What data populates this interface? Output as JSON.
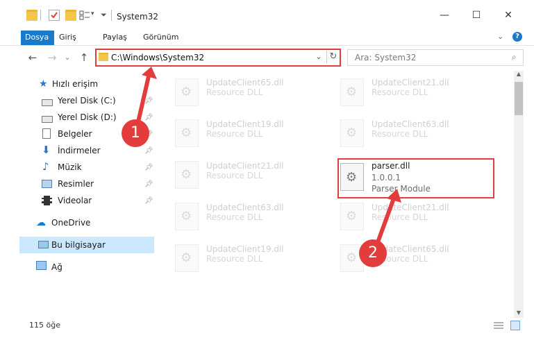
{
  "window": {
    "title": "System32",
    "minimize": "—",
    "maximize": "☐",
    "close": "✕"
  },
  "ribbon": {
    "tabs": [
      "Dosya",
      "Giriş",
      "Paylaş",
      "Görünüm"
    ]
  },
  "nav": {
    "back": "←",
    "forward": "→",
    "recent": "⌄",
    "up": "↑",
    "address": "C:\\Windows\\System32",
    "address_dropdown": "⌄",
    "refresh": "↻",
    "search_placeholder": "Ara: System32"
  },
  "sidebar": {
    "quick_access": "Hızlı erişim",
    "items": [
      {
        "label": "Yerel Disk (C:)",
        "icon": "drive-icon"
      },
      {
        "label": "Yerel Disk (D:)",
        "icon": "drive-icon"
      },
      {
        "label": "Belgeler",
        "icon": "documents-icon"
      },
      {
        "label": "İndirmeler",
        "icon": "download-icon"
      },
      {
        "label": "Müzik",
        "icon": "music-icon"
      },
      {
        "label": "Resimler",
        "icon": "pictures-icon"
      },
      {
        "label": "Videolar",
        "icon": "videos-icon"
      }
    ],
    "onedrive": "OneDrive",
    "this_pc": "Bu bilgisayar",
    "network": "Ağ"
  },
  "files": {
    "left": [
      {
        "name": "UpdateClient65.dll",
        "desc": "Resource DLL"
      },
      {
        "name": "UpdateClient19.dll",
        "desc": "Resource DLL"
      },
      {
        "name": "UpdateClient21.dll",
        "desc": "Resource DLL"
      },
      {
        "name": "UpdateClient63.dll",
        "desc": "Resource DLL"
      },
      {
        "name": "UpdateClient19.dll",
        "desc": "Resource DLL"
      }
    ],
    "right": [
      {
        "name": "UpdateClient21.dll",
        "desc": "Resource DLL"
      },
      {
        "name": "UpdateClient63.dll",
        "desc": "Resource DLL"
      },
      {
        "name": "UpdateClient21.dll",
        "desc": "Resource DLL"
      },
      {
        "name": "UpdateClient65.dll",
        "desc": "Resource DLL"
      }
    ],
    "selected": {
      "name": "parser.dll",
      "version": "1.0.0.1",
      "desc": "Parser Module"
    }
  },
  "status": {
    "count": "115 öğe"
  },
  "callouts": {
    "one": "1",
    "two": "2"
  },
  "colors": {
    "accent": "#1979ca",
    "annotation": "#e23c3c",
    "selection": "#cce8ff"
  }
}
